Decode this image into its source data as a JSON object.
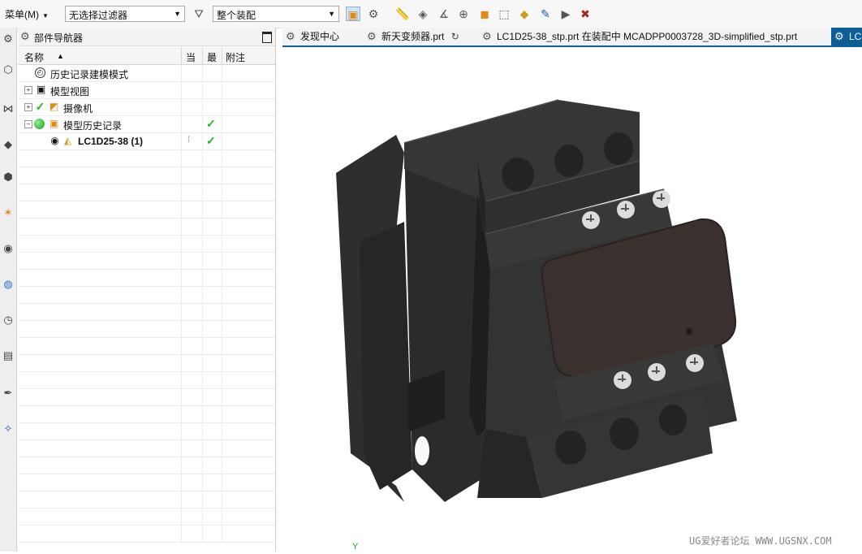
{
  "toolbar": {
    "menu_label": "菜单(M)",
    "filter_select": "无选择过滤器",
    "assembly_select": "整个装配"
  },
  "navigator": {
    "title": "部件导航器",
    "columns": {
      "name": "名称",
      "current": "当",
      "latest": "最",
      "notes": "附注"
    },
    "nodes": [
      {
        "label": "历史记录建模模式",
        "icon": "clock-icon"
      },
      {
        "label": "模型视图",
        "icon": "model-views-icon"
      },
      {
        "label": "摄像机",
        "icon": "camera-icon"
      },
      {
        "label": "模型历史记录",
        "icon": "model-history-icon"
      },
      {
        "label": "LC1D25-38 (1)",
        "icon": "body-icon"
      }
    ]
  },
  "tabs": [
    {
      "label": "发现中心"
    },
    {
      "label": "新天变频器.prt"
    },
    {
      "label": "LC1D25-38_stp.prt 在装配中 MCADPP0003728_3D-simplified_stp.prt"
    },
    {
      "label": "LC"
    }
  ],
  "viewport": {
    "axis_label": "Y",
    "watermark": "UG爱好者论坛 WWW.UGSNX.COM"
  },
  "colors": {
    "accent": "#0d5e97",
    "check": "#1fb51f",
    "model_body": "#333333",
    "model_cover": "#3a302d"
  }
}
